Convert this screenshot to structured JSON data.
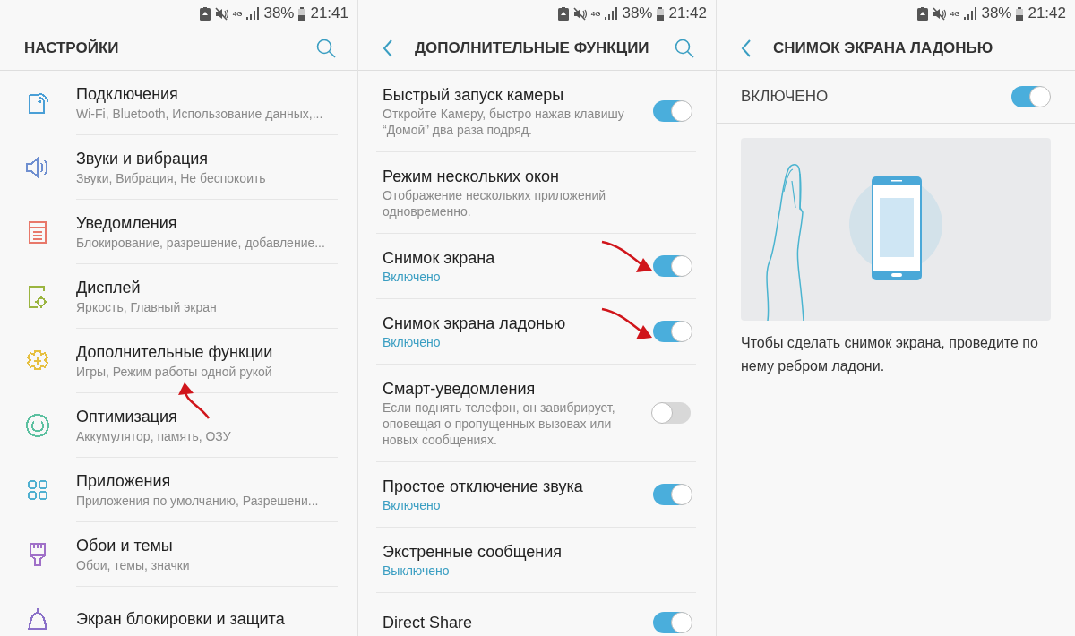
{
  "settings_screen": {
    "status_bar": {
      "network": "4G",
      "battery": "38%",
      "time": "21:41"
    },
    "header": {
      "title": "НАСТРОЙКИ",
      "has_back": false,
      "has_search": true
    },
    "items": [
      {
        "title": "Подключения",
        "summary": "Wi-Fi, Bluetooth, Использование данных,...",
        "color": "#4a9fd6"
      },
      {
        "title": "Звуки и вибрация",
        "summary": "Звуки, Вибрация, Не беспокоить",
        "color": "#6f8fd0"
      },
      {
        "title": "Уведомления",
        "summary": "Блокирование, разрешение, добавление...",
        "color": "#e8786a"
      },
      {
        "title": "Дисплей",
        "summary": "Яркость, Главный экран",
        "color": "#9bb540"
      },
      {
        "title": "Дополнительные функции",
        "summary": "Игры, Режим работы одной рукой",
        "color": "#e6c040"
      },
      {
        "title": "Оптимизация",
        "summary": "Аккумулятор, память, ОЗУ",
        "color": "#5cc0a0"
      },
      {
        "title": "Приложения",
        "summary": "Приложения по умолчанию, Разрешени...",
        "color": "#50b0d0"
      },
      {
        "title": "Обои и темы",
        "summary": "Обои, темы, значки",
        "color": "#a070c8"
      },
      {
        "title": "Экран блокировки и защита",
        "color": "#8a70c8"
      }
    ]
  },
  "advanced_features_screen": {
    "status_bar": {
      "network": "4G",
      "battery": "38%",
      "time": "21:42"
    },
    "header": {
      "title": "ДОПОЛНИТЕЛЬНЫЕ ФУНКЦИИ",
      "has_back": true,
      "has_search": true
    },
    "items": [
      {
        "title": "Быстрый запуск камеры",
        "description": "Откройте Камеру, быстро нажав клавишу “Домой” два раза подряд.",
        "on": true,
        "split": false
      },
      {
        "title": "Режим нескольких окон",
        "description": "Отображение нескольких приложений одновременно.",
        "split": false
      },
      {
        "title": "Снимок экрана",
        "status": "Включено",
        "on": true,
        "split": false
      },
      {
        "title": "Снимок экрана ладонью",
        "status": "Включено",
        "on": true,
        "split": false
      },
      {
        "title": "Смарт-уведомления",
        "description": "Если поднять телефон, он завибрирует, оповещая о пропущенных вызовах или новых сообщениях.",
        "on": false,
        "split": true
      },
      {
        "title": "Простое отключение звука",
        "status": "Включено",
        "on": true,
        "split": true
      },
      {
        "title": "Экстренные сообщения",
        "status": "Выключено",
        "split": false
      },
      {
        "title": "Direct Share",
        "on": true,
        "split": true
      }
    ]
  },
  "palm_swipe_screen": {
    "status_bar": {
      "network": "4G",
      "battery": "38%",
      "time": "21:42"
    },
    "header": {
      "title": "СНИМОК ЭКРАНА ЛАДОНЬЮ",
      "has_back": true,
      "has_search": false
    },
    "master_switch": {
      "label": "ВКЛЮЧЕНО",
      "on": true
    },
    "description": "Чтобы сделать снимок экрана, проведите по нему ребром ладони."
  }
}
